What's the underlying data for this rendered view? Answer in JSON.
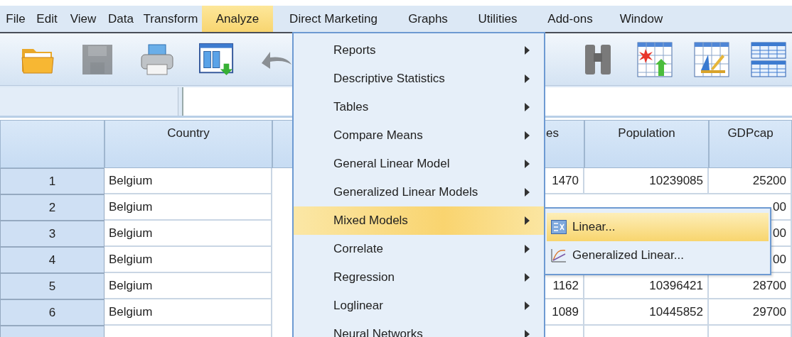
{
  "menubar": [
    {
      "label": "File",
      "selected": false
    },
    {
      "label": "Edit",
      "selected": false
    },
    {
      "label": "View",
      "selected": false
    },
    {
      "label": "Data",
      "selected": false
    },
    {
      "label": "Transform",
      "selected": false
    },
    {
      "label": "Analyze",
      "selected": true
    },
    {
      "label": "Direct Marketing",
      "selected": false
    },
    {
      "label": "Graphs",
      "selected": false
    },
    {
      "label": "Utilities",
      "selected": false
    },
    {
      "label": "Add-ons",
      "selected": false
    },
    {
      "label": "Window",
      "selected": false
    }
  ],
  "toolbar_left": [
    {
      "kind": "folder",
      "disabled": false
    },
    {
      "kind": "disk",
      "disabled": true
    },
    {
      "kind": "printer",
      "disabled": false
    },
    {
      "kind": "dialog",
      "disabled": false
    },
    {
      "kind": "undo",
      "disabled": true
    }
  ],
  "toolbar_right": [
    {
      "kind": "binoculars",
      "disabled": false
    },
    {
      "kind": "insert",
      "disabled": false
    },
    {
      "kind": "variable",
      "disabled": false
    },
    {
      "kind": "grid",
      "disabled": false
    }
  ],
  "table": {
    "columns": [
      "Country",
      null,
      "es",
      "Population",
      "GDPcap"
    ],
    "rows": [
      {
        "number": "1",
        "cells": [
          "Belgium",
          null,
          "1470",
          "10239085",
          "25200"
        ]
      },
      {
        "number": "2",
        "cells": [
          "Belgium",
          null,
          null,
          null,
          "00"
        ]
      },
      {
        "number": "3",
        "cells": [
          "Belgium",
          null,
          null,
          null,
          "00"
        ]
      },
      {
        "number": "4",
        "cells": [
          "Belgium",
          null,
          null,
          null,
          "00"
        ]
      },
      {
        "number": "5",
        "cells": [
          "Belgium",
          null,
          "1162",
          "10396421",
          "28700"
        ]
      },
      {
        "number": "6",
        "cells": [
          "Belgium",
          null,
          "1089",
          "10445852",
          "29700"
        ]
      }
    ]
  },
  "analyze_menu": [
    {
      "label": "Reports",
      "submenu": true,
      "selected": false
    },
    {
      "label": "Descriptive Statistics",
      "submenu": true,
      "selected": false
    },
    {
      "label": "Tables",
      "submenu": true,
      "selected": false
    },
    {
      "label": "Compare Means",
      "submenu": true,
      "selected": false
    },
    {
      "label": "General Linear Model",
      "submenu": true,
      "selected": false
    },
    {
      "label": "Generalized Linear Models",
      "submenu": true,
      "selected": false
    },
    {
      "label": "Mixed Models",
      "submenu": true,
      "selected": true
    },
    {
      "label": "Correlate",
      "submenu": true,
      "selected": false
    },
    {
      "label": "Regression",
      "submenu": true,
      "selected": false
    },
    {
      "label": "Loglinear",
      "submenu": true,
      "selected": false
    },
    {
      "label": "Neural Networks",
      "submenu": true,
      "selected": false
    }
  ],
  "mixed_models_submenu": [
    {
      "label": "Linear...",
      "kind": "matrix",
      "selected": true
    },
    {
      "label": "Generalized Linear...",
      "kind": "curves",
      "selected": false
    }
  ]
}
